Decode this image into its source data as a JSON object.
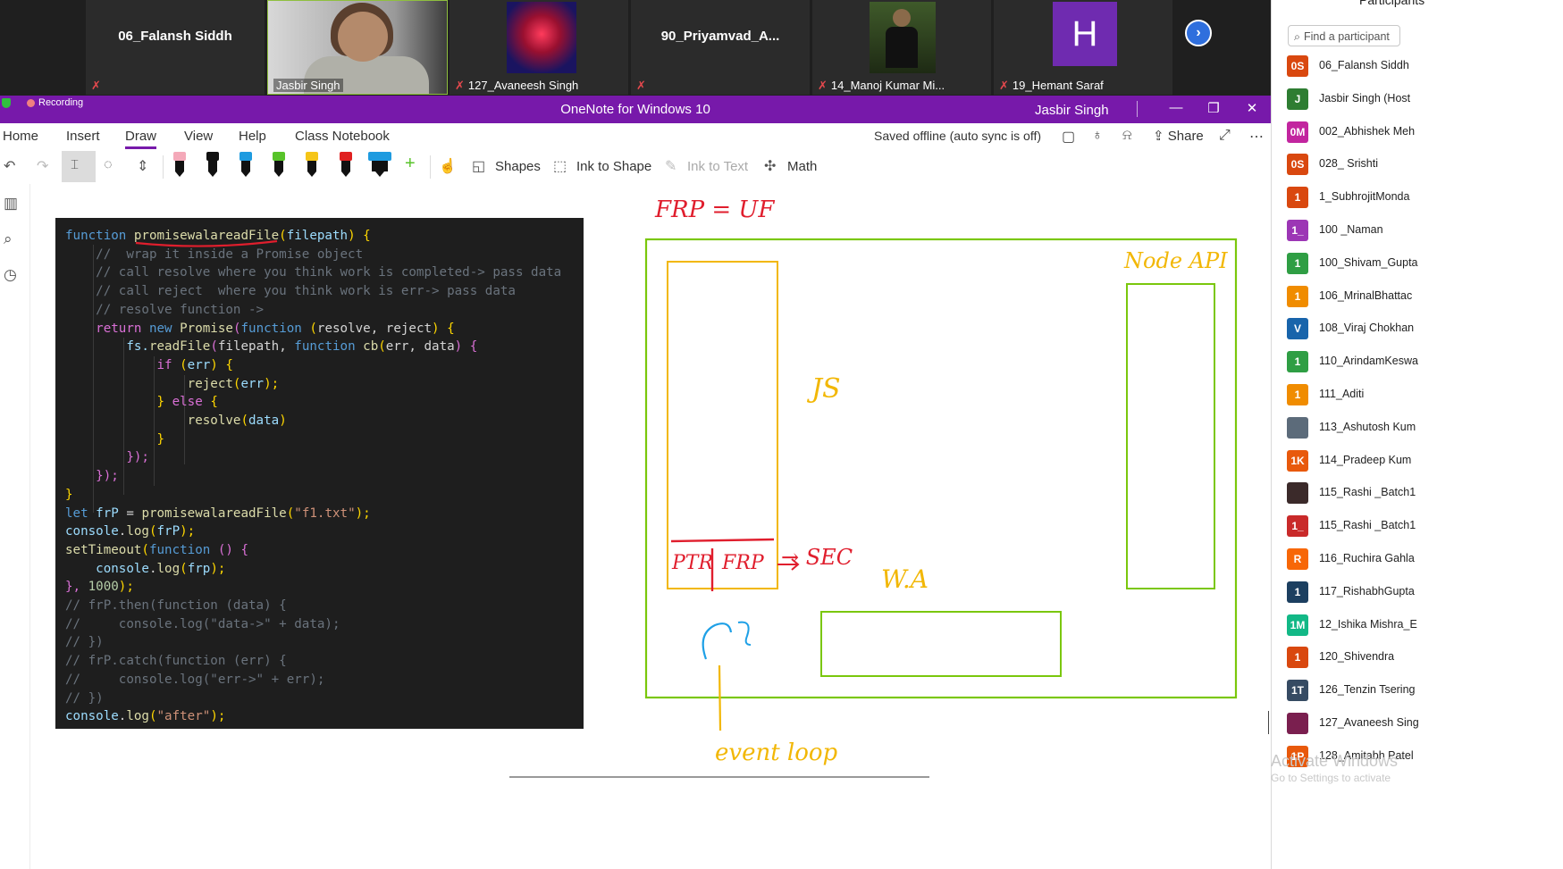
{
  "video_tiles": [
    {
      "name": "06_Falansh Siddh",
      "caption": ""
    },
    {
      "name": "",
      "caption": "Jasbir Singh"
    },
    {
      "name": "",
      "caption": "127_Avaneesh Singh"
    },
    {
      "name": "90_Priyamvad_A...",
      "caption": ""
    },
    {
      "name": "",
      "caption": "14_Manoj Kumar Mi..."
    },
    {
      "name": "",
      "caption": "19_Hemant Saraf",
      "avatar_letter": "H"
    }
  ],
  "window": {
    "recording": "Recording",
    "title": "OneNote for Windows 10",
    "user": "Jasbir Singh",
    "min": "—",
    "restore": "❐",
    "close": "✕"
  },
  "menu": {
    "items": [
      "Home",
      "Insert",
      "Draw",
      "View",
      "Help",
      "Class Notebook"
    ],
    "active": "Draw",
    "saved_status": "Saved offline (auto sync is off)",
    "share": "Share"
  },
  "toolbar": {
    "shapes": "Shapes",
    "ink_to_shape": "Ink to Shape",
    "ink_to_text": "Ink to Text",
    "math": "Math",
    "pens": [
      {
        "color": "#f4a9b9"
      },
      {
        "color": "#111111"
      },
      {
        "color": "#1e9be0"
      },
      {
        "color": "#58c32a"
      },
      {
        "color": "#f5c518"
      },
      {
        "color": "#e02020"
      },
      {
        "color": "#1e9be0"
      }
    ]
  },
  "code_lines": [
    [
      {
        "t": "function ",
        "c": "k"
      },
      {
        "t": "promisewalareadFile",
        "c": "f"
      },
      {
        "t": "(",
        "c": "y"
      },
      {
        "t": "filepath",
        "c": "v"
      },
      {
        "t": ") {",
        "c": "y"
      }
    ],
    [
      {
        "t": "    //  wrap it inside a Promise object",
        "c": "c"
      }
    ],
    [
      {
        "t": "    // call resolve where you think work is completed-> pass data",
        "c": "c"
      }
    ],
    [
      {
        "t": "    // call reject  where you think work is err-> pass data",
        "c": "c"
      }
    ],
    [
      {
        "t": "    // resolve function ->",
        "c": "c"
      }
    ],
    [
      {
        "t": "    ",
        "c": "p"
      },
      {
        "t": "return ",
        "c": "b"
      },
      {
        "t": "new ",
        "c": "k"
      },
      {
        "t": "Promise",
        "c": "f"
      },
      {
        "t": "(",
        "c": "b"
      },
      {
        "t": "function ",
        "c": "k"
      },
      {
        "t": "(",
        "c": "y"
      },
      {
        "t": "resolve, reject",
        "c": "p"
      },
      {
        "t": ") {",
        "c": "y"
      }
    ],
    [
      {
        "t": "        fs.",
        "c": "v"
      },
      {
        "t": "readFile",
        "c": "f"
      },
      {
        "t": "(",
        "c": "b"
      },
      {
        "t": "filepath, ",
        "c": "p"
      },
      {
        "t": "function ",
        "c": "k"
      },
      {
        "t": "cb",
        "c": "f"
      },
      {
        "t": "(",
        "c": "y"
      },
      {
        "t": "err, data",
        "c": "p"
      },
      {
        "t": ") {",
        "c": "b"
      }
    ],
    [
      {
        "t": "            ",
        "c": "p"
      },
      {
        "t": "if ",
        "c": "b"
      },
      {
        "t": "(",
        "c": "y"
      },
      {
        "t": "err",
        "c": "v"
      },
      {
        "t": ") {",
        "c": "y"
      }
    ],
    [
      {
        "t": "                ",
        "c": "p"
      },
      {
        "t": "reject",
        "c": "f"
      },
      {
        "t": "(",
        "c": "y"
      },
      {
        "t": "err",
        "c": "v"
      },
      {
        "t": ");",
        "c": "y"
      }
    ],
    [
      {
        "t": "            } ",
        "c": "y"
      },
      {
        "t": "else ",
        "c": "b"
      },
      {
        "t": "{",
        "c": "y"
      }
    ],
    [
      {
        "t": "                ",
        "c": "p"
      },
      {
        "t": "resolve",
        "c": "f"
      },
      {
        "t": "(",
        "c": "y"
      },
      {
        "t": "data",
        "c": "v"
      },
      {
        "t": ")",
        "c": "y"
      }
    ],
    [
      {
        "t": "            }",
        "c": "y"
      }
    ],
    [
      {
        "t": "        });",
        "c": "b"
      }
    ],
    [
      {
        "t": "    });",
        "c": "b"
      }
    ],
    [
      {
        "t": "}",
        "c": "y"
      }
    ],
    [
      {
        "t": "let ",
        "c": "k"
      },
      {
        "t": "frP ",
        "c": "v"
      },
      {
        "t": "= ",
        "c": "p"
      },
      {
        "t": "promisewalareadFile",
        "c": "f"
      },
      {
        "t": "(",
        "c": "y"
      },
      {
        "t": "\"f1.txt\"",
        "c": "s"
      },
      {
        "t": ");",
        "c": "y"
      }
    ],
    [
      {
        "t": "console",
        "c": "v"
      },
      {
        "t": ".",
        "c": "p"
      },
      {
        "t": "log",
        "c": "f"
      },
      {
        "t": "(",
        "c": "y"
      },
      {
        "t": "frP",
        "c": "v"
      },
      {
        "t": ");",
        "c": "y"
      }
    ],
    [
      {
        "t": "setTimeout",
        "c": "f"
      },
      {
        "t": "(",
        "c": "y"
      },
      {
        "t": "function ",
        "c": "k"
      },
      {
        "t": "() {",
        "c": "b"
      }
    ],
    [
      {
        "t": "    console",
        "c": "v"
      },
      {
        "t": ".",
        "c": "p"
      },
      {
        "t": "log",
        "c": "f"
      },
      {
        "t": "(",
        "c": "y"
      },
      {
        "t": "frp",
        "c": "v"
      },
      {
        "t": ");",
        "c": "y"
      }
    ],
    [
      {
        "t": "}, ",
        "c": "b"
      },
      {
        "t": "1000",
        "c": "n"
      },
      {
        "t": ");",
        "c": "y"
      }
    ],
    [
      {
        "t": "// frP.then(function (data) {",
        "c": "c"
      }
    ],
    [
      {
        "t": "//     console.log(\"data->\" + data);",
        "c": "c"
      }
    ],
    [
      {
        "t": "// })",
        "c": "c"
      }
    ],
    [
      {
        "t": "// frP.catch(function (err) {",
        "c": "c"
      }
    ],
    [
      {
        "t": "//     console.log(\"err->\" + err);",
        "c": "c"
      }
    ],
    [
      {
        "t": "// })",
        "c": "c"
      }
    ],
    [
      {
        "t": "console",
        "c": "v"
      },
      {
        "t": ".",
        "c": "p"
      },
      {
        "t": "log",
        "c": "f"
      },
      {
        "t": "(",
        "c": "y"
      },
      {
        "t": "\"after\"",
        "c": "s"
      },
      {
        "t": ");",
        "c": "y"
      }
    ]
  ],
  "ink": {
    "frp_uf": "FRP = UF",
    "node_api": "Node API",
    "js": "JS",
    "ptr": "PTR",
    "frp": "FRP",
    "sec": "→ SEC",
    "wa": "W.A",
    "event_loop": "event loop",
    "colors": {
      "red": "#e01e2d",
      "yellow": "#f2b705",
      "green": "#7ac70c",
      "blue": "#1ea0e6"
    }
  },
  "participants": {
    "title": "Participants",
    "search_placeholder": "Find a participant",
    "list": [
      {
        "initials": "0S",
        "color": "#d9480f",
        "name": "06_Falansh Siddh"
      },
      {
        "initials": "J",
        "color": "#2e7d32",
        "name": "Jasbir Singh (Host"
      },
      {
        "initials": "0M",
        "color": "#c2259f",
        "name": "002_Abhishek Meh"
      },
      {
        "initials": "0S",
        "color": "#d9480f",
        "name": "028_ Srishti"
      },
      {
        "initials": "1",
        "color": "#d9480f",
        "name": "1_SubhrojitMonda"
      },
      {
        "initials": "1_",
        "color": "#9c36b5",
        "name": "100 _Naman"
      },
      {
        "initials": "1",
        "color": "#2f9e44",
        "name": "100_Shivam_Gupta"
      },
      {
        "initials": "1",
        "color": "#f08c00",
        "name": "106_MrinalBhattac"
      },
      {
        "initials": "V",
        "color": "#1864ab",
        "name": "108_Viraj Chokhan"
      },
      {
        "initials": "1",
        "color": "#2f9e44",
        "name": "110_ArindamKeswa"
      },
      {
        "initials": "1",
        "color": "#f08c00",
        "name": "111_Aditi"
      },
      {
        "initials": "",
        "color": "#5c6b7a",
        "name": "113_Ashutosh Kum"
      },
      {
        "initials": "1K",
        "color": "#e8590c",
        "name": "114_Pradeep Kum"
      },
      {
        "initials": "",
        "color": "#3b2a2a",
        "name": "115_Rashi _Batch1"
      },
      {
        "initials": "1_",
        "color": "#c92a2a",
        "name": "115_Rashi _Batch1"
      },
      {
        "initials": "R",
        "color": "#f76707",
        "name": "116_Ruchira Gahla"
      },
      {
        "initials": "1",
        "color": "#1c3f60",
        "name": "117_RishabhGupta"
      },
      {
        "initials": "1M",
        "color": "#12b886",
        "name": "12_Ishika Mishra_E"
      },
      {
        "initials": "1",
        "color": "#d9480f",
        "name": "120_Shivendra"
      },
      {
        "initials": "1T",
        "color": "#364b63",
        "name": "126_Tenzin Tsering"
      },
      {
        "initials": "",
        "color": "#7a1f4f",
        "name": "127_Avaneesh Sing"
      },
      {
        "initials": "1P",
        "color": "#e8590c",
        "name": "128_Amitabh Patel"
      }
    ]
  },
  "watermark": {
    "line1": "Activate Windows",
    "line2": "Go to Settings to activate"
  }
}
